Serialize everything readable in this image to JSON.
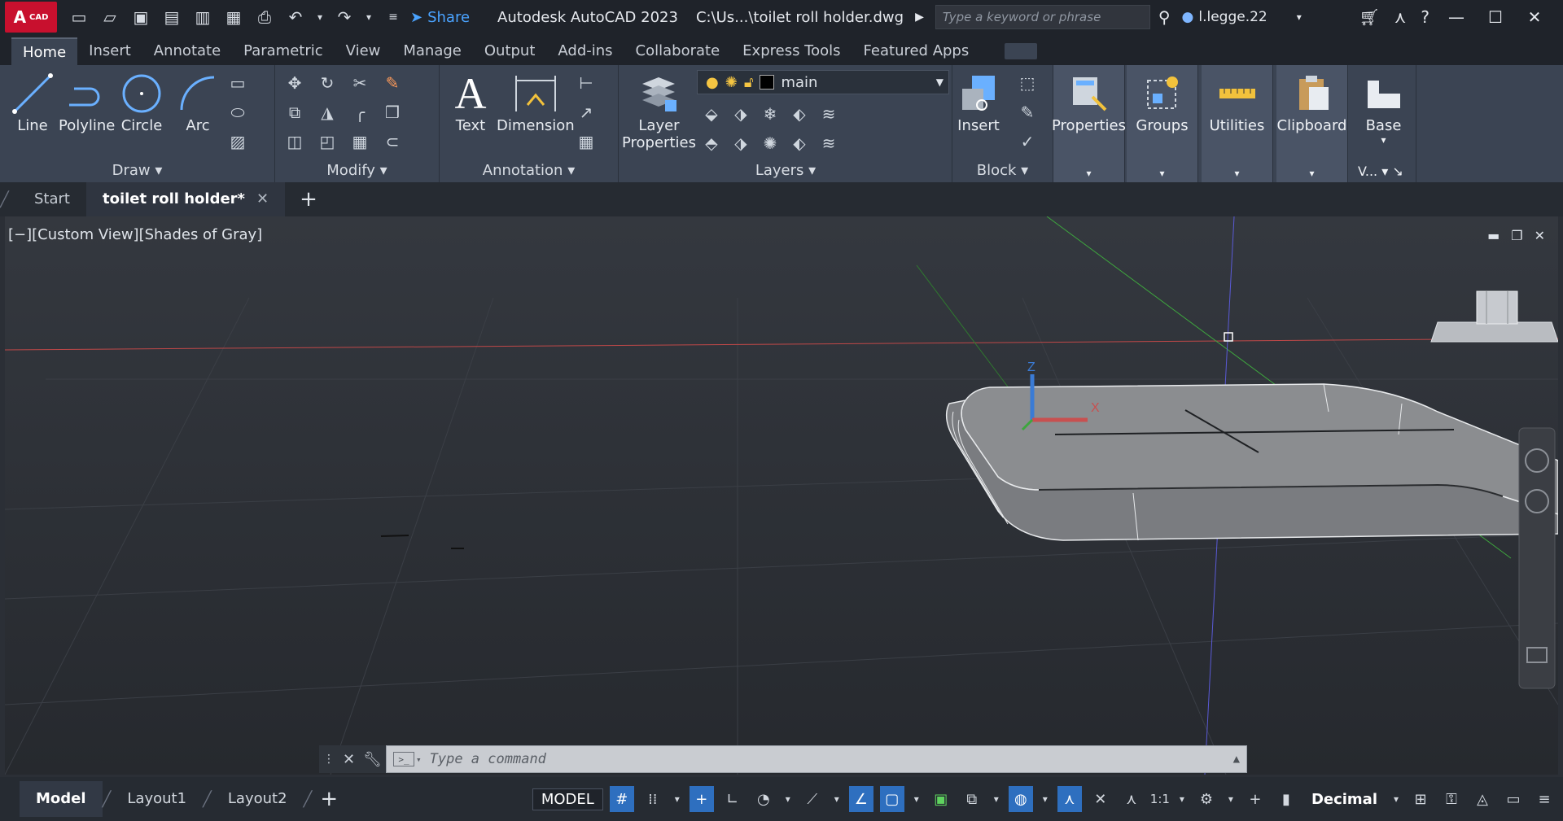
{
  "titlebar": {
    "logo_text": "A",
    "logo_sub": "CAD",
    "share_label": "Share",
    "app_title": "Autodesk AutoCAD 2023",
    "file_title": "C:\\Us...\\toilet roll holder.dwg",
    "search_placeholder": "Type a keyword or phrase",
    "user_name": "l.legge.22"
  },
  "ribbon_tabs": [
    "Home",
    "Insert",
    "Annotate",
    "Parametric",
    "View",
    "Manage",
    "Output",
    "Add-ins",
    "Collaborate",
    "Express Tools",
    "Featured Apps"
  ],
  "ribbon": {
    "draw": {
      "title": "Draw",
      "line": "Line",
      "polyline": "Polyline",
      "circle": "Circle",
      "arc": "Arc"
    },
    "modify": {
      "title": "Modify"
    },
    "annotation": {
      "title": "Annotation",
      "text": "Text",
      "dimension": "Dimension"
    },
    "layers": {
      "title": "Layers",
      "layer_properties_1": "Layer",
      "layer_properties_2": "Properties",
      "current_layer": "main"
    },
    "block": {
      "title": "Block",
      "insert": "Insert"
    },
    "properties": "Properties",
    "groups": "Groups",
    "utilities": "Utilities",
    "clipboard": "Clipboard",
    "base": "Base",
    "view_short": "V..."
  },
  "doc_tabs": {
    "start": "Start",
    "active": "toilet roll holder*"
  },
  "viewport": {
    "label": "[−][Custom View][Shades of Gray]",
    "axis_z": "Z",
    "axis_x": "X"
  },
  "command": {
    "placeholder": "Type a command"
  },
  "status": {
    "layout_tabs": [
      "Model",
      "Layout1",
      "Layout2"
    ],
    "model_button": "MODEL",
    "scale": "1:1",
    "units": "Decimal"
  },
  "colors": {
    "accent_blue": "#2e6fbf",
    "logo_red": "#c8102e",
    "ribbon_bg": "#3b4453"
  }
}
